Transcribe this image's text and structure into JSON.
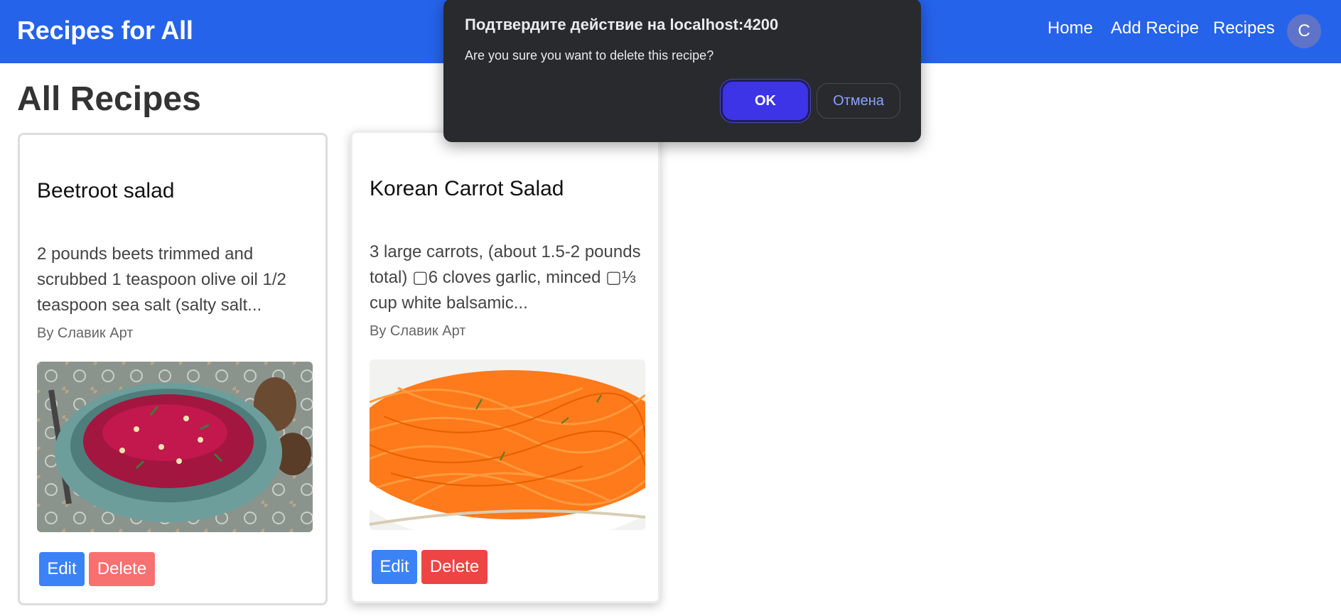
{
  "header": {
    "brand": "Recipes for All",
    "nav": {
      "home": "Home",
      "add_recipe": "Add Recipe",
      "recipes": "Recipes"
    },
    "avatar_initial": "C",
    "colors": {
      "bar": "#2563eb",
      "avatar": "#5f74c8"
    }
  },
  "page": {
    "title": "All Recipes"
  },
  "cards": [
    {
      "title": "Beetroot salad",
      "description": "2 pounds beets trimmed and scrubbed 1 teaspoon olive oil 1/2 teaspoon sea salt (salty salt...",
      "author": "By Славик Арт",
      "image_icon": "beetroot-salad-photo",
      "edit_label": "Edit",
      "delete_label": "Delete"
    },
    {
      "title": "Korean Carrot Salad",
      "description": "3 large carrots, (about 1.5-2 pounds total) ▢6 cloves garlic, minced ▢⅓ cup white balsamic...",
      "author": "By Славик Арт",
      "image_icon": "carrot-salad-photo",
      "edit_label": "Edit",
      "delete_label": "Delete"
    }
  ],
  "dialog": {
    "title": "Подтвердите действие на localhost:4200",
    "message": "Are you sure you want to delete this recipe?",
    "ok_label": "OK",
    "cancel_label": "Отмена"
  }
}
